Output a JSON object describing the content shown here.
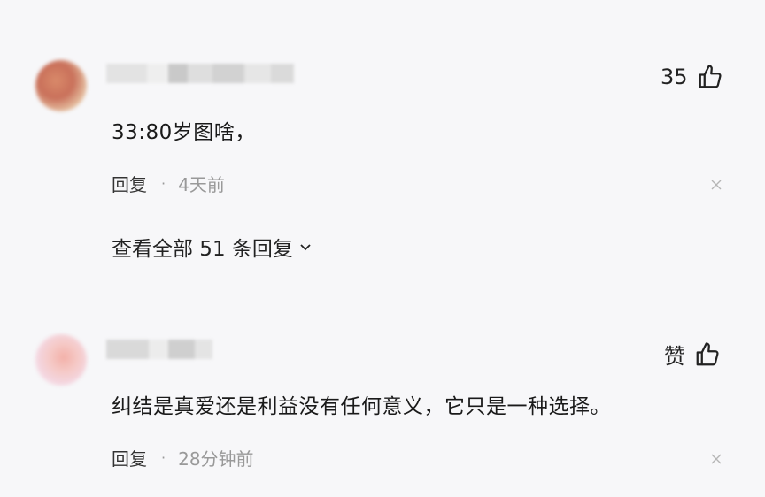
{
  "comments": [
    {
      "like_count": "35",
      "text": "33:80岁图啥，",
      "reply_label": "回复",
      "separator": "·",
      "time": "4天前",
      "view_all_label": "查看全部 51 条回复"
    },
    {
      "like_count": "赞",
      "text": "纠结是真爱还是利益没有任何意义，它只是一种选择。",
      "reply_label": "回复",
      "separator": "·",
      "time": "28分钟前"
    }
  ],
  "icons": {
    "like": "thumbs-up-icon",
    "close": "close-icon",
    "expand": "chevron-down-icon"
  },
  "colors": {
    "background": "#f7f7f9",
    "text": "#1a1a1a",
    "muted": "#999999"
  }
}
